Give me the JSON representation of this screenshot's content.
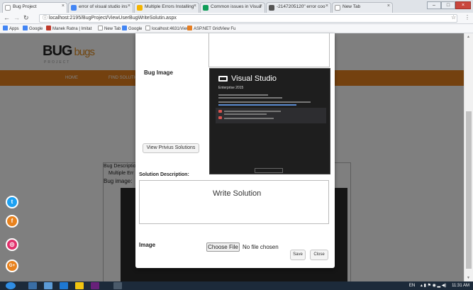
{
  "browser": {
    "tabs": [
      {
        "title": "Bug Project",
        "active": true,
        "icon_color": "#ffffff"
      },
      {
        "title": "error of visual studio ins",
        "active": false,
        "icon_color": "#4285f4"
      },
      {
        "title": "Multiple Errors Installing",
        "active": false,
        "icon_color": "#f4b400"
      },
      {
        "title": "Common issues in Visua",
        "active": false,
        "icon_color": "#0f9d58"
      },
      {
        "title": "-2147205120\" error coo",
        "active": false,
        "icon_color": "#555555"
      },
      {
        "title": "New Tab",
        "active": false,
        "icon_color": "#ffffff"
      }
    ],
    "url": "localhost:2195/BugProject/ViewUserBugWriteSolutin.aspx",
    "bookmarks": [
      {
        "label": "Apps",
        "color": "#4285f4"
      },
      {
        "label": "Google",
        "color": "#4285f4"
      },
      {
        "label": "Manek Ratna | Imitat",
        "color": "#c0392b"
      },
      {
        "label": "New Tab",
        "color": "#ffffff"
      },
      {
        "label": "Google",
        "color": "#4285f4"
      },
      {
        "label": "localhost:4631/View/",
        "color": "#ffffff"
      },
      {
        "label": "ASP.NET GridView Fu",
        "color": "#e67e22"
      }
    ]
  },
  "site": {
    "logo_main": "BUG",
    "logo_accent": "bugs",
    "logo_sub": "PROJECT",
    "nav": [
      "HOME",
      "FIND SOLUTIO"
    ],
    "accent_color": "#e8821e"
  },
  "background_form": {
    "bug_description_label": "Bug Descriptio",
    "bug_description_value": "Multiple Err",
    "bug_image_label": "Bug image:"
  },
  "modal": {
    "bug_image_label": "Bug Image",
    "vs_title": "Visual Studio",
    "vs_edition": "Enterprise 2015",
    "view_solutions_button": "View Privius Solutions",
    "write_solution_title": "Write Solution",
    "solution_description_label": "Solution Description:",
    "image_label": "Image",
    "choose_file_button": "Choose File",
    "no_file_text": "No file chosen",
    "save_button": "Save",
    "close_button": "Close"
  },
  "social": [
    {
      "icon": "twitter-icon",
      "glyph": "t",
      "color": "#1da1f2"
    },
    {
      "icon": "facebook-icon",
      "glyph": "f",
      "color": "#e8821e"
    },
    {
      "icon": "instagram-icon",
      "glyph": "◎",
      "color": "#e1306c"
    },
    {
      "icon": "google-plus-icon",
      "glyph": "G+",
      "color": "#e8821e"
    }
  ],
  "taskbar": {
    "tray_text": "EN",
    "clock": "11:31 AM"
  }
}
